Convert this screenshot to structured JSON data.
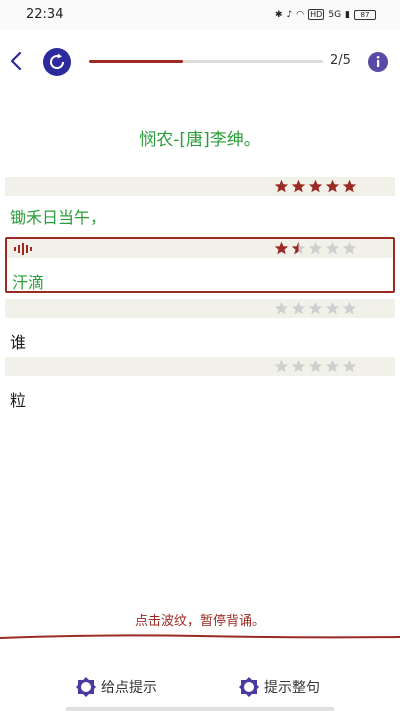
{
  "status_bar": {
    "time": "22:34",
    "network": "HD",
    "signal": "5G",
    "battery": "87"
  },
  "header": {
    "progress": {
      "current": 2,
      "total": 5,
      "text": "2/5",
      "fraction": 0.4
    },
    "progress_color": "#9b2a22"
  },
  "poem": {
    "title": "悯农-[唐]李绅。",
    "lines": [
      {
        "text": "锄禾日当午，",
        "stars": 5,
        "state": "done"
      },
      {
        "text": "汗滴",
        "stars": 1.5,
        "state": "active"
      },
      {
        "text": "谁",
        "stars": 0,
        "state": "pending"
      },
      {
        "text": "粒",
        "stars": 0,
        "state": "pending"
      }
    ]
  },
  "footer": {
    "hint": "点击波纹，暂停背诵。",
    "buttons": [
      {
        "label": "给点提示",
        "icon": "hint-badge-icon"
      },
      {
        "label": "提示整句",
        "icon": "hint-badge-icon"
      }
    ]
  },
  "colors": {
    "accent": "#9b2a22",
    "green": "#2a9d3a",
    "icon_blue": "#2c2a9c",
    "star_filled": "#9b2a22",
    "star_empty": "#cfcfcf"
  }
}
